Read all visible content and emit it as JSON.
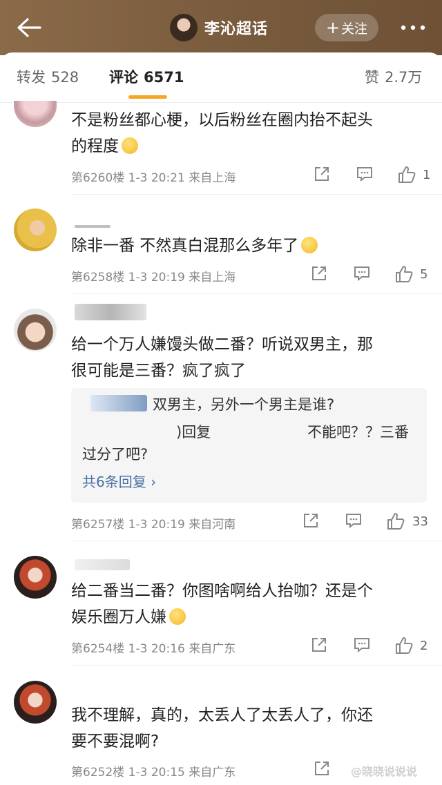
{
  "header": {
    "title": "李沁超话",
    "follow_label": "+ 关注",
    "follow_text": "关注"
  },
  "tabs": {
    "repost": {
      "label": "转发",
      "count": "528"
    },
    "comment": {
      "label": "评论",
      "count": "6571"
    },
    "like": {
      "label": "赞",
      "count": "2.7万"
    }
  },
  "comments": [
    {
      "text_line1": "不是粉丝都心梗，以后粉丝在圈内抬不起头",
      "text_line2": "的程度",
      "floor": "第6260楼",
      "date": "1-3",
      "time": "20:21",
      "location": "来自上海",
      "likes": "1"
    },
    {
      "text_line1": "除非一番   不然真白混那么多年了",
      "floor": "第6258楼",
      "date": "1-3",
      "time": "20:19",
      "location": "来自上海",
      "likes": "5"
    },
    {
      "text_line1": "给一个万人嫌馒头做二番？听说双男主，那",
      "text_line2": "很可能是三番？疯了疯了",
      "floor": "第6257楼",
      "date": "1-3",
      "time": "20:19",
      "location": "来自河南",
      "likes": "33",
      "replies": {
        "reply1": "双男主，另外一个男主是谁?",
        "reply2_prefix": ")回复",
        "reply2_text": "不能吧？？三番",
        "reply2_line2": "过分了吧?",
        "more_label": "共6条回复 ›"
      }
    },
    {
      "text_line1": "给二番当二番？你图啥啊给人抬咖？还是个",
      "text_line2": "娱乐圈万人嫌",
      "floor": "第6254楼",
      "date": "1-3",
      "time": "20:16",
      "location": "来自广东",
      "likes": "2"
    },
    {
      "text_line1": "我不理解，真的，太丢人了太丢人了，你还",
      "text_line2": "要不要混啊?",
      "floor": "第6252楼",
      "date": "1-3",
      "time": "20:15",
      "location": "来自广东",
      "likes": ""
    }
  ],
  "watermark": "@晓晓说说说",
  "colors": {
    "header_bg": "#7a5c3e",
    "tab_underline": "#f5a623",
    "link": "#4a6fa5"
  }
}
